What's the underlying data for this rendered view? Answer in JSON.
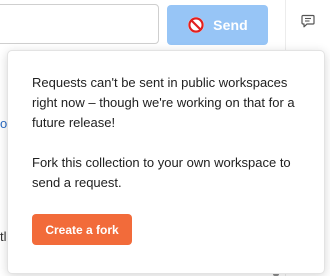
{
  "toolbar": {
    "send_label": "Send",
    "send_icon": "ban-icon",
    "send_state": "disabled"
  },
  "sidebar": {
    "icon": "comment-icon"
  },
  "background": {
    "link_fragment": "o",
    "text_fragment": "tl"
  },
  "popover": {
    "message_1": "Requests can't be sent in public workspaces right now – though we're working on that for a future release!",
    "message_2": "Fork this collection to your own workspace to send a request.",
    "fork_button_label": "Create a fork"
  },
  "colors": {
    "send_disabled": "#97c5f6",
    "ban_red": "#e02020",
    "fork_orange": "#f26b3a",
    "link_blue": "#2b6cc4"
  }
}
